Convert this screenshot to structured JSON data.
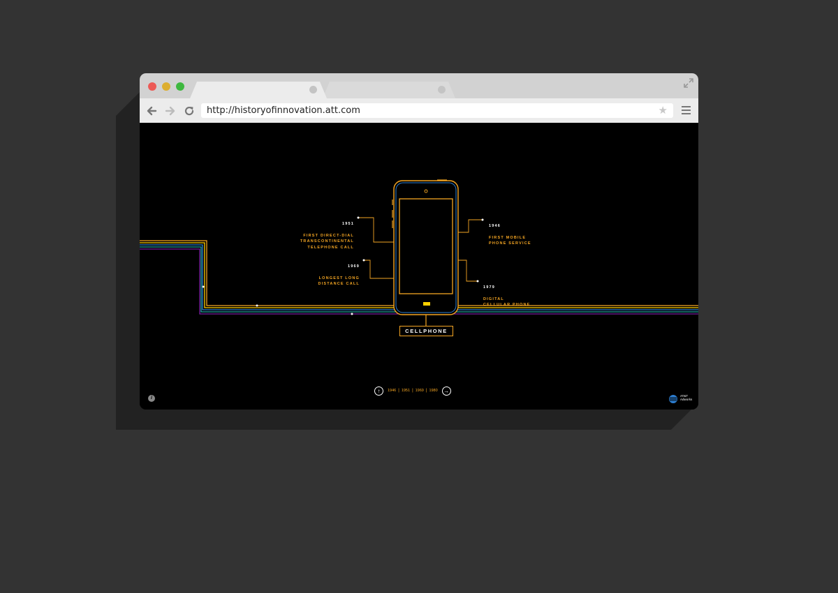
{
  "browser": {
    "url": "http://historyofinnovation.att.com"
  },
  "page": {
    "device_label": "CELLPHONE",
    "annotations": [
      {
        "year": "1951",
        "text": "FIRST DIRECT-DIAL\nTRANSCONTINENTAL\nTELEPHONE CALL"
      },
      {
        "year": "1969",
        "text": "LONGEST LONG\nDISTANCE CALL"
      },
      {
        "year": "1946",
        "text": "FIRST MOBILE\nPHONE SERVICE"
      },
      {
        "year": "1979",
        "text": "DIGITAL\nCELLULAR PHONE"
      }
    ],
    "timeline": {
      "prev_icon": "circle-up-arrow-icon",
      "next_icon": "circle-right-arrow-icon",
      "years": [
        "1946",
        "1951",
        "1969",
        "1980"
      ]
    },
    "logo_text": "AT&T\nAdworks",
    "colors": {
      "orange": "#f5a623",
      "yellow": "#ffd000",
      "blue": "#2d7fd3",
      "teal": "#20a4a4",
      "purple": "#7a1fa2",
      "background": "#000000"
    }
  }
}
